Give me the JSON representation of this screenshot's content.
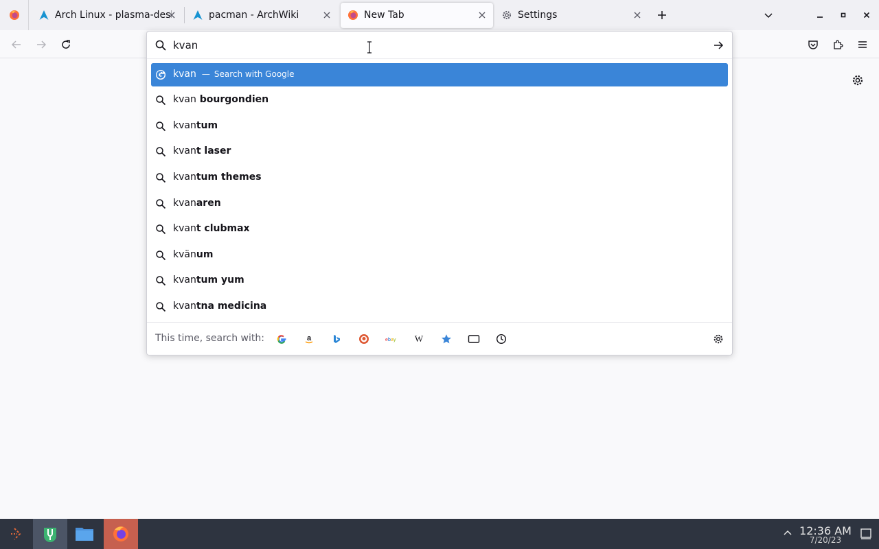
{
  "tabs": [
    {
      "title": "Arch Linux - plasma-desk",
      "icon": "arch-logo-icon"
    },
    {
      "title": "pacman - ArchWiki",
      "icon": "arch-logo-icon"
    },
    {
      "title": "New Tab",
      "icon": "firefox-icon",
      "selected": true
    },
    {
      "title": "Settings",
      "icon": "gear-icon"
    }
  ],
  "urlbar": {
    "value": "kvan",
    "placeholder": ""
  },
  "suggestions": [
    {
      "typed": "kvan",
      "rest": "",
      "separator": "—",
      "action": "Search with Google",
      "icon": "google-icon",
      "selected": true
    },
    {
      "typed": "kvan",
      "rest": " bourgondien",
      "icon": "search-icon"
    },
    {
      "typed": "kvan",
      "rest": "tum",
      "icon": "search-icon"
    },
    {
      "typed": "kvan",
      "rest": "t laser",
      "icon": "search-icon"
    },
    {
      "typed": "kvan",
      "rest": "tum themes",
      "icon": "search-icon"
    },
    {
      "typed": "kvan",
      "rest": "aren",
      "icon": "search-icon"
    },
    {
      "typed": "kvan",
      "rest": "t clubmax",
      "icon": "search-icon"
    },
    {
      "typed": "kvän",
      "rest": "um",
      "icon": "search-icon"
    },
    {
      "typed": "kvan",
      "rest": "tum yum",
      "icon": "search-icon"
    },
    {
      "typed": "kvan",
      "rest": "tna medicina",
      "icon": "search-icon"
    }
  ],
  "oneoff": {
    "label": "This time, search with:",
    "engines": [
      "google-icon",
      "amazon-icon",
      "bing-icon",
      "duckduckgo-icon",
      "ebay-icon",
      "wikipedia-icon",
      "bookmarks-icon",
      "tabs-icon",
      "history-icon"
    ]
  },
  "clock": {
    "time": "12:36 AM",
    "date": "7/20/23"
  },
  "colors": {
    "accent": "#3a85d8",
    "taskbar": "#2e3440"
  }
}
